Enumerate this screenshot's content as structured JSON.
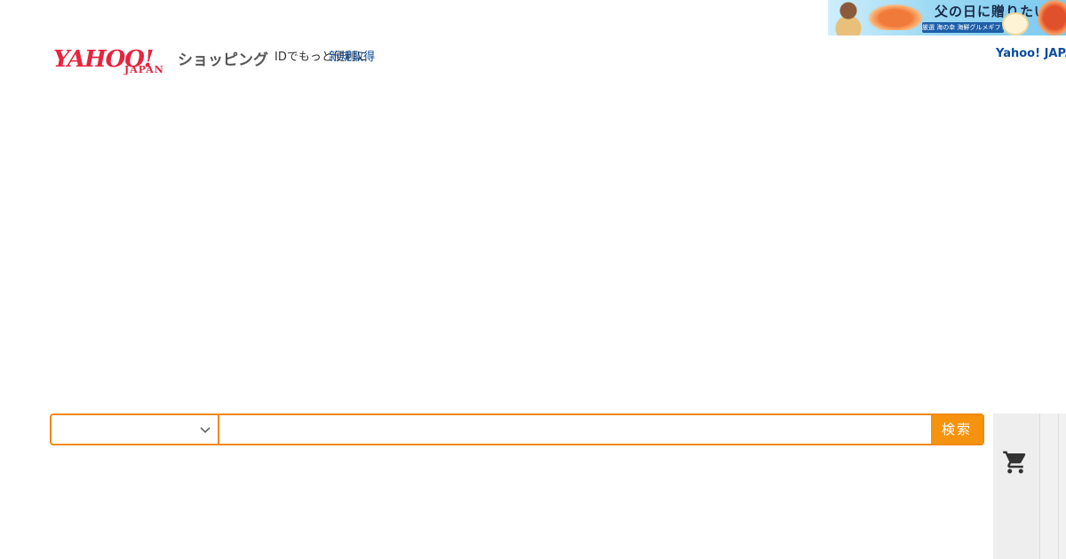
{
  "banner": {
    "headline": "父の日に贈りたい",
    "ribbon": "厳選 海の幸 海鮮グルメギフト"
  },
  "header": {
    "logo_text": "YAHOO!",
    "logo_sub": "JAPAN",
    "service_name": "ショッピング",
    "id_text": "IDでもっと便利に",
    "id_link": "新規取得",
    "top_link": "Yahoo! JAPAN"
  },
  "search": {
    "category_value": "",
    "query_value": "",
    "button_label": "検索"
  },
  "colors": {
    "brand_red": "#e8233f",
    "accent_orange": "#f0890f",
    "link_blue": "#0b4d9e"
  },
  "icons": {
    "category_dropdown": "chevron-down-icon",
    "side_cart": "cart-icon"
  }
}
